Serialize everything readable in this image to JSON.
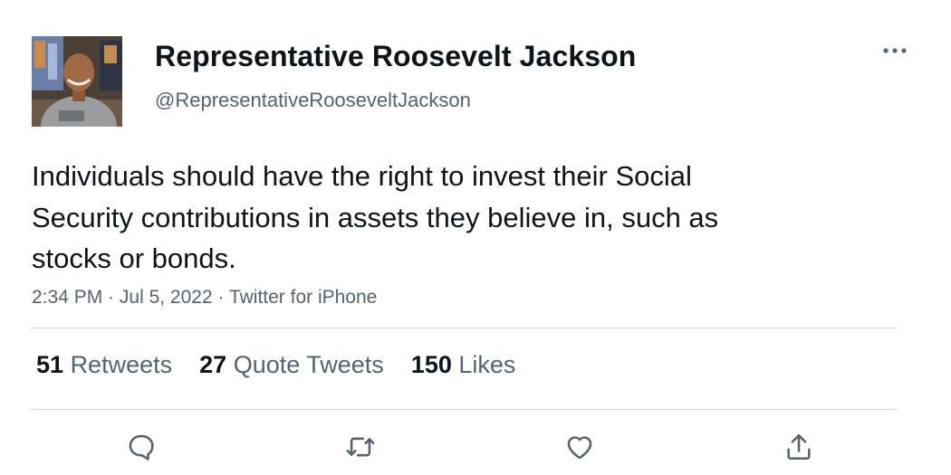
{
  "author": {
    "display_name": "Representative Roosevelt Jackson",
    "handle": "@RepresentativeRooseveltJackson"
  },
  "tweet": {
    "text": "Individuals should have the right to invest their Social Security contributions in assets they believe in, such as stocks or bonds.",
    "time": "2:34 PM",
    "separator_1": " · ",
    "date": "Jul 5, 2022",
    "separator_2": " · ",
    "source": "Twitter for iPhone"
  },
  "stats": {
    "retweets_count": "51",
    "retweets_label": "Retweets",
    "quotes_count": "27",
    "quotes_label": "Quote Tweets",
    "likes_count": "150",
    "likes_label": "Likes"
  },
  "icons": {
    "more": "more-horizontal-icon",
    "reply": "reply-icon",
    "retweet": "retweet-icon",
    "like": "heart-icon",
    "share": "share-icon"
  },
  "colors": {
    "text": "#0f1419",
    "secondary": "#536471",
    "divider": "#cfd9de"
  }
}
